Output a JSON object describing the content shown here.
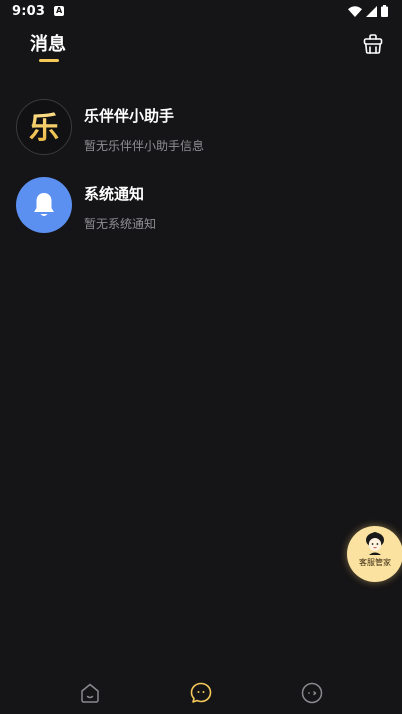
{
  "status_bar": {
    "time": "9:03",
    "notification_icon": "a-notification-icon",
    "icons": [
      "wifi-icon",
      "signal-icon",
      "battery-icon"
    ]
  },
  "header": {
    "title": "消息",
    "accent_color": "#f5c85a",
    "action_icon": "clean-basket-icon"
  },
  "messages": [
    {
      "title": "乐伴伴小助手",
      "subtitle": "暂无乐伴伴小助手信息",
      "avatar_icon": "app-logo-icon",
      "avatar_text": "乐"
    },
    {
      "title": "系统通知",
      "subtitle": "暂无系统通知",
      "avatar_icon": "bell-icon",
      "avatar_color": "#5b8ff0"
    }
  ],
  "service_float": {
    "label": "客服管家",
    "icon": "customer-service-avatar-icon"
  },
  "bottom_nav": {
    "items": [
      {
        "icon": "home-icon",
        "active": false
      },
      {
        "icon": "message-icon",
        "active": true
      },
      {
        "icon": "profile-icon",
        "active": false
      }
    ],
    "active_color": "#f5c85a",
    "inactive_color": "#8a8a8e"
  }
}
